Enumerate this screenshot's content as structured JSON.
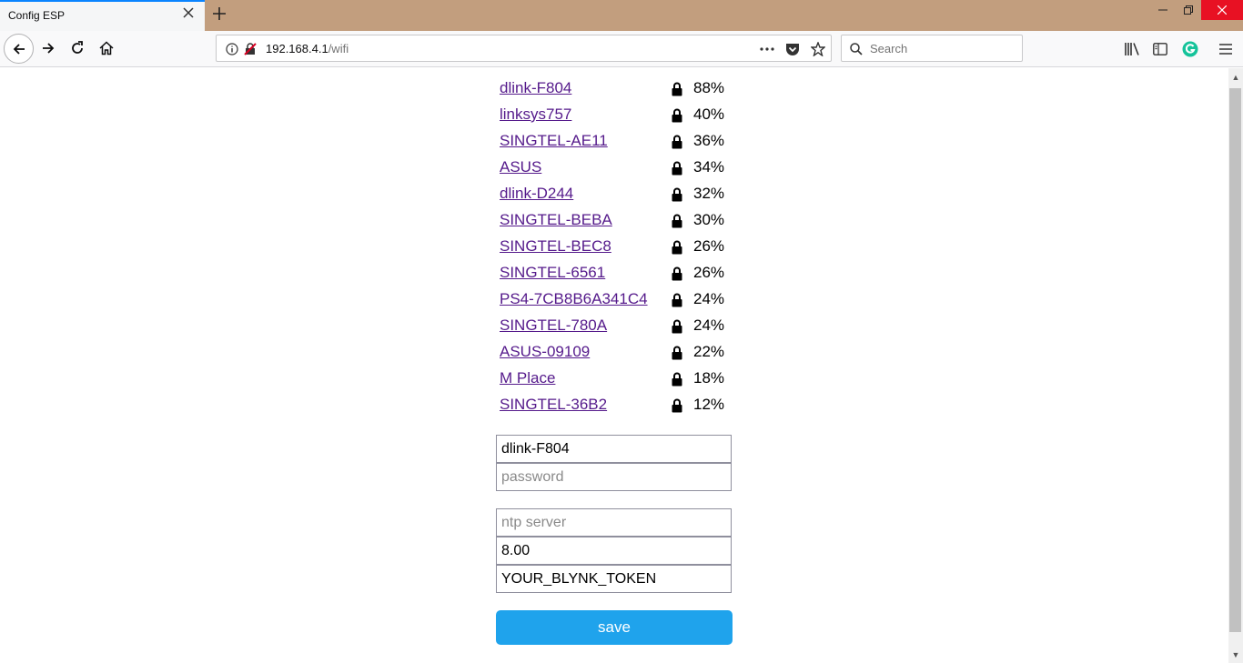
{
  "browser": {
    "tab_title": "Config ESP",
    "url_host": "192.168.4.1",
    "url_path": "/wifi",
    "search_placeholder": "Search",
    "accent_color": "#0a84ff",
    "icons": [
      "back-icon",
      "forward-icon",
      "reload-icon",
      "home-icon",
      "info-icon",
      "insecure-lock-icon",
      "more-icon",
      "pocket-icon",
      "bookmark-star-icon",
      "search-icon",
      "library-icon",
      "sidebar-icon",
      "grammarly-icon",
      "menu-icon",
      "minimize-icon",
      "restore-icon",
      "close-icon"
    ]
  },
  "networks": [
    {
      "ssid": "dlink-F804",
      "signal": "88%"
    },
    {
      "ssid": "linksys757",
      "signal": "40%"
    },
    {
      "ssid": "SINGTEL-AE11",
      "signal": "36%"
    },
    {
      "ssid": "ASUS",
      "signal": "34%"
    },
    {
      "ssid": "dlink-D244",
      "signal": "32%"
    },
    {
      "ssid": "SINGTEL-BEBA",
      "signal": "30%"
    },
    {
      "ssid": "SINGTEL-BEC8",
      "signal": "26%"
    },
    {
      "ssid": "SINGTEL-6561",
      "signal": "26%"
    },
    {
      "ssid": "PS4-7CB8B6A341C4",
      "signal": "24%"
    },
    {
      "ssid": "SINGTEL-780A",
      "signal": "24%"
    },
    {
      "ssid": "ASUS-09109",
      "signal": "22%"
    },
    {
      "ssid": "M Place",
      "signal": "18%"
    },
    {
      "ssid": "SINGTEL-36B2",
      "signal": "12%"
    }
  ],
  "form": {
    "ssid_value": "dlink-F804",
    "password_placeholder": "password",
    "ntp_placeholder": "ntp server",
    "timezone_value": "8.00",
    "token_value": "YOUR_BLYNK_TOKEN",
    "save_label": "save",
    "save_color": "#1fa3ec"
  }
}
